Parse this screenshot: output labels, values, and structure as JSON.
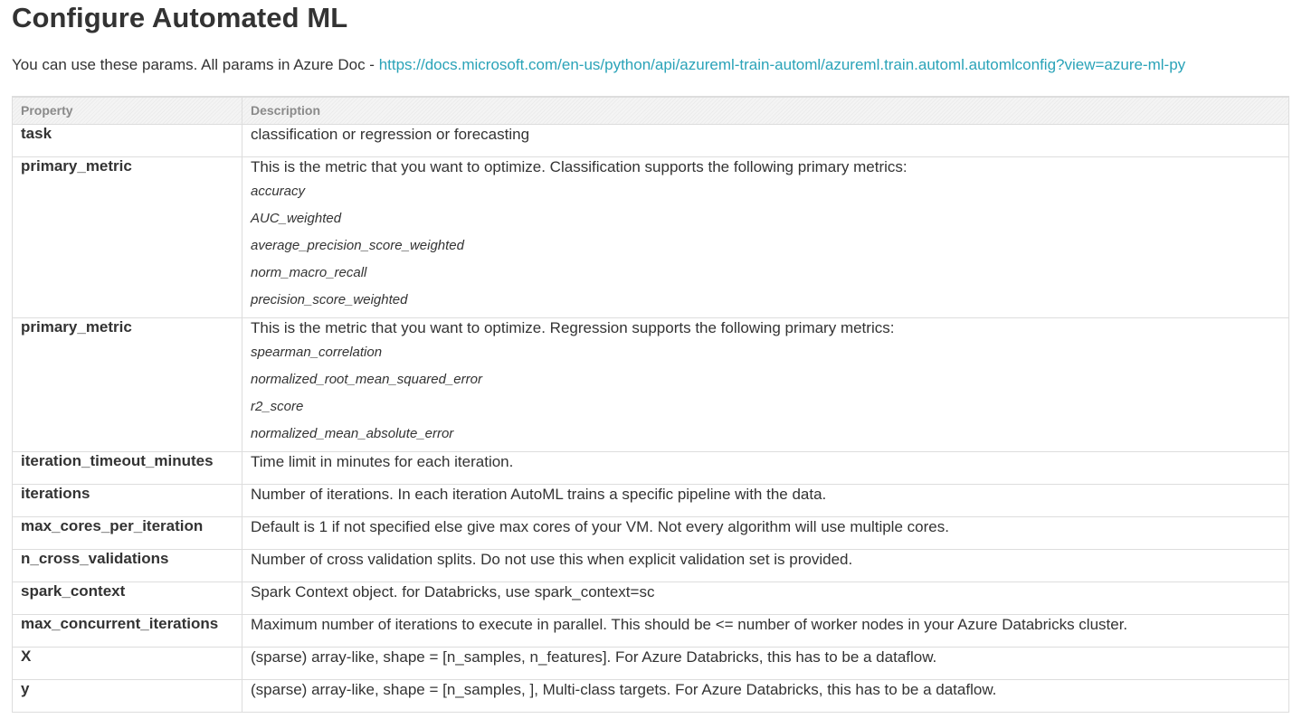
{
  "page": {
    "title": "Configure Automated ML",
    "intro_text": "You can use these params. All params in Azure Doc - ",
    "intro_link": "https://docs.microsoft.com/en-us/python/api/azureml-train-automl/azureml.train.automl.automlconfig?view=azure-ml-py",
    "link_color": "#2aa3b8"
  },
  "table": {
    "headers": {
      "property": "Property",
      "description": "Description"
    },
    "rows": [
      {
        "property": "task",
        "description": "classification or regression or forecasting",
        "metrics": []
      },
      {
        "property": "primary_metric",
        "description": "This is the metric that you want to optimize. Classification supports the following primary metrics:",
        "metrics": [
          "accuracy",
          "AUC_weighted",
          "average_precision_score_weighted",
          "norm_macro_recall",
          "precision_score_weighted"
        ]
      },
      {
        "property": "primary_metric",
        "description": "This is the metric that you want to optimize. Regression supports the following primary metrics:",
        "metrics": [
          "spearman_correlation",
          "normalized_root_mean_squared_error",
          "r2_score",
          "normalized_mean_absolute_error"
        ]
      },
      {
        "property": "iteration_timeout_minutes",
        "description": "Time limit in minutes for each iteration.",
        "metrics": []
      },
      {
        "property": "iterations",
        "description": "Number of iterations. In each iteration AutoML trains a specific pipeline with the data.",
        "metrics": []
      },
      {
        "property": "max_cores_per_iteration",
        "description": "Default is 1 if not specified else give max cores of your VM. Not every algorithm will use multiple cores.",
        "metrics": []
      },
      {
        "property": "n_cross_validations",
        "description": "Number of cross validation splits. Do not use this when explicit validation set is provided.",
        "metrics": []
      },
      {
        "property": "spark_context",
        "description": "Spark Context object. for Databricks, use spark_context=sc",
        "metrics": []
      },
      {
        "property": "max_concurrent_iterations",
        "description": "Maximum number of iterations to execute in parallel. This should be <= number of worker nodes in your Azure Databricks cluster.",
        "metrics": []
      },
      {
        "property": "X",
        "description": "(sparse) array-like, shape = [n_samples, n_features]. For Azure Databricks, this has to be a dataflow.",
        "metrics": []
      },
      {
        "property": "y",
        "description": "(sparse) array-like, shape = [n_samples, ], Multi-class targets. For Azure Databricks, this has to be a dataflow.",
        "metrics": []
      }
    ]
  }
}
